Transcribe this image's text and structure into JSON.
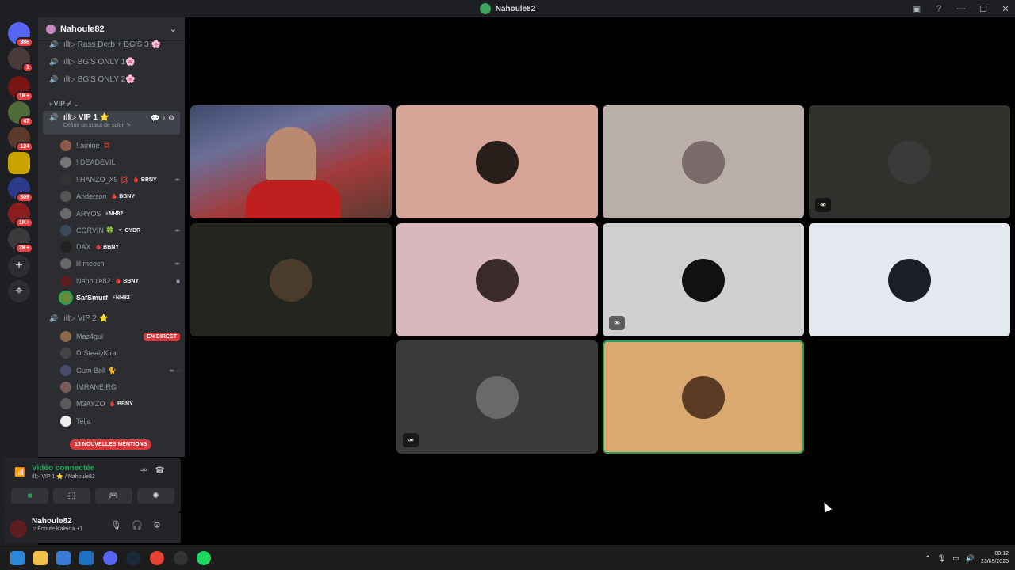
{
  "window": {
    "title": "Nahoule82",
    "controls": {
      "minimize": "—",
      "maximize": "☐",
      "close": "✕"
    }
  },
  "server_rail": {
    "servers": [
      {
        "name": "Discord home",
        "badge": "986"
      },
      {
        "name": "server-2",
        "badge": "1"
      },
      {
        "name": "server-3",
        "badge": "1K+"
      },
      {
        "name": "server-4",
        "badge": "47"
      },
      {
        "name": "server-5",
        "badge": "124"
      },
      {
        "name": "server-6",
        "badge": ""
      },
      {
        "name": "server-7",
        "badge": "309"
      },
      {
        "name": "server-8",
        "badge": "1K+"
      },
      {
        "name": "server-9",
        "badge": "2K+"
      }
    ],
    "add_label": "+",
    "explore_label": "⌖"
  },
  "guild": {
    "name": "Nahoule82",
    "channels_top": [
      {
        "name": "ıll▷ Rass Derb + BG'S 3 🌸"
      },
      {
        "name": "ıll▷ BG'S ONLY 1🌸"
      },
      {
        "name": "ıll▷ BG'S ONLY 2🌸"
      }
    ],
    "category": "› VIP ⌿ ⌄",
    "active_channel": {
      "name": "ıll▷ VIP 1 ⭐",
      "status": "Définir un statut de salon ✎",
      "actions": "💬♪⚙"
    },
    "vip1_users": [
      {
        "name": "! amine",
        "tag": "💢",
        "right": ""
      },
      {
        "name": "! DEADEVIL",
        "tag": "",
        "right": ""
      },
      {
        "name": "! HANZO_X9 💢",
        "tag": "🩸 BBNY",
        "right": "⚮"
      },
      {
        "name": "Anderson",
        "tag": "🩸 BBNY",
        "right": ""
      },
      {
        "name": "ARYOS",
        "tag": "⚡NH82",
        "right": ""
      },
      {
        "name": "CORVIN 🍀",
        "tag": "✒ CYBR",
        "right": "⚮"
      },
      {
        "name": "DAX",
        "tag": "🩸 BBNY",
        "right": ""
      },
      {
        "name": "lil meech",
        "tag": "",
        "right": "⚮"
      },
      {
        "name": "Nahoule82",
        "tag": "🩸 BBNY",
        "right": "■"
      },
      {
        "name": "SafSmurf",
        "tag": "⚡NH82",
        "right": ""
      }
    ],
    "vip2_channel": "ıll▷ VIP 2 ⭐",
    "vip2_users": [
      {
        "name": "Maz4gui",
        "tag": "",
        "live": "EN DIRECT"
      },
      {
        "name": "DrStealyKira",
        "tag": "",
        "live": ""
      },
      {
        "name": "Gum Boll 🐈",
        "tag": "",
        "live": "",
        "right": "⚮ ◌"
      },
      {
        "name": "IMRANE RG",
        "tag": "",
        "live": ""
      },
      {
        "name": "M3AYZO",
        "tag": "🩸 BBNY",
        "live": ""
      },
      {
        "name": "Telja",
        "tag": "",
        "live": ""
      }
    ],
    "mentions_pill": "13 NOUVELLES MENTIONS"
  },
  "voice_panel": {
    "status": "Vidéo connectée",
    "channel_path": "ıll▷ VIP 1 ⭐ / Nahoule82",
    "buttons": [
      "■",
      "⬚",
      "🎮",
      "✺"
    ]
  },
  "user_bar": {
    "name": "Nahoule82",
    "activity": "♫ Écoute Kaleida +1"
  },
  "colors": {
    "tiles": [
      "#3a3a3a",
      "#d6a597",
      "#b9aeaa",
      "#2f322c",
      "#23261f",
      "#d8b8bc",
      "#d0d0d0",
      "#e4e9f0",
      "#3b393a",
      "#d9a96f"
    ],
    "speaking": "#23a55a"
  },
  "tray": {
    "time": "00:12",
    "date": "23/09/2025"
  }
}
